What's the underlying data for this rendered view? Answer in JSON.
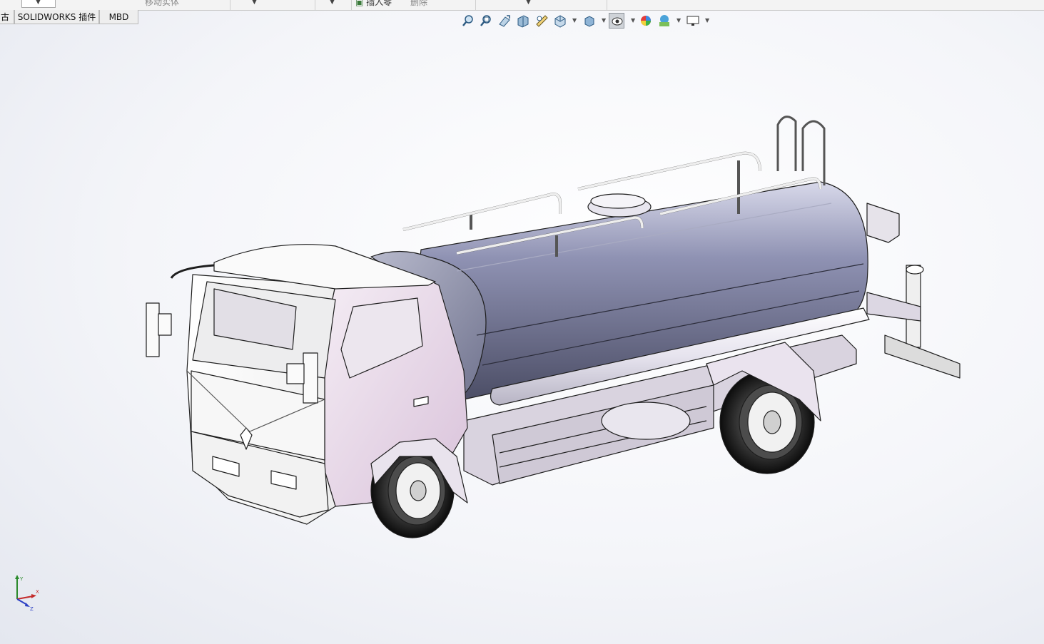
{
  "toolbar": {
    "move_body_label": "移动实体",
    "insert_part_label": "插入零",
    "delete_label": "删除"
  },
  "tabs": [
    {
      "label": "古"
    },
    {
      "label": "SOLIDWORKS 插件"
    },
    {
      "label": "MBD"
    }
  ],
  "view_toolbar": {
    "icons": [
      "zoom-to-fit-icon",
      "zoom-to-area-icon",
      "previous-view-icon",
      "section-view-icon",
      "dynamic-annotation-icon",
      "view-orientation-icon",
      "display-style-icon",
      "hide-show-items-icon",
      "edit-appearance-icon",
      "apply-scene-icon",
      "view-settings-icon"
    ]
  },
  "model": {
    "name": "water-tanker-truck",
    "cab_color": "#e3cfe3",
    "tank_color": "#6f7290"
  },
  "triad": {
    "x": "X",
    "y": "Y",
    "z": "Z"
  }
}
